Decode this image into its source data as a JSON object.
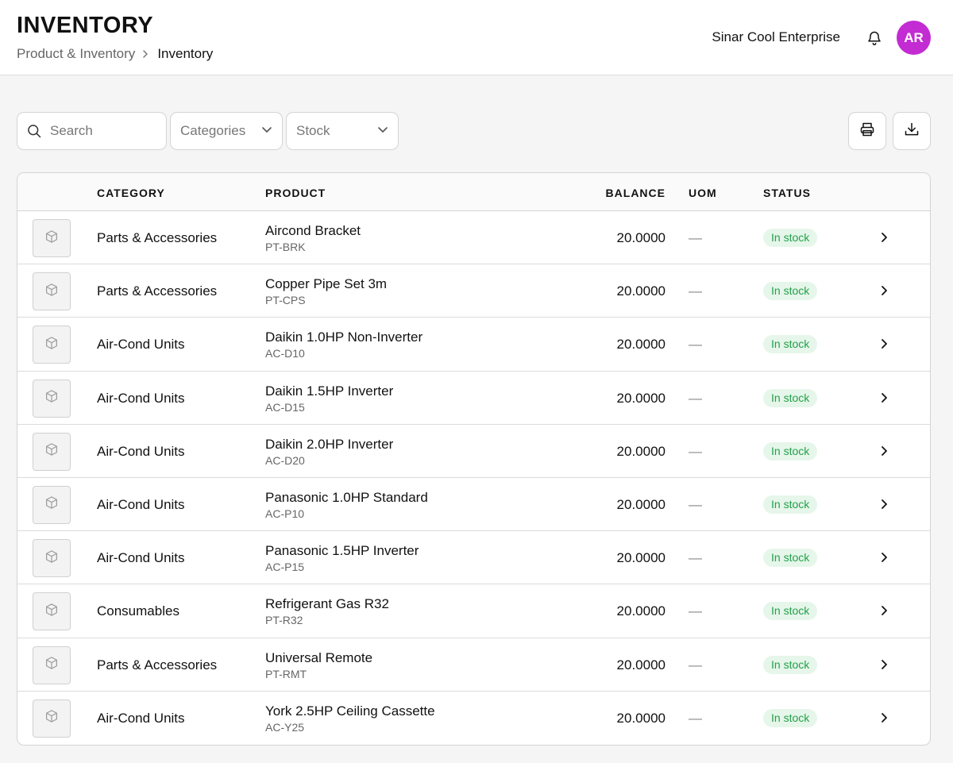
{
  "header": {
    "title": "INVENTORY",
    "breadcrumb": {
      "parent": "Product & Inventory",
      "current": "Inventory"
    },
    "company": "Sinar Cool Enterprise",
    "avatar_initials": "AR",
    "avatar_color": "#c32bd3",
    "icons": {
      "notifications": "bell-icon"
    }
  },
  "toolbar": {
    "search_placeholder": "Search",
    "categories_label": "Categories",
    "stock_label": "Stock",
    "icons": {
      "search": "search-icon",
      "print": "printer-icon",
      "download": "download-icon"
    }
  },
  "table": {
    "columns": {
      "category": "CATEGORY",
      "product": "PRODUCT",
      "balance": "BALANCE",
      "uom": "UOM",
      "status": "STATUS"
    },
    "status_colors": {
      "bg": "#e6f6ea",
      "text": "#23a04a"
    },
    "rows": [
      {
        "category": "Parts & Accessories",
        "name": "Aircond Bracket",
        "code": "PT-BRK",
        "balance": "20.0000",
        "uom": "—",
        "status": "In stock"
      },
      {
        "category": "Parts & Accessories",
        "name": "Copper Pipe Set 3m",
        "code": "PT-CPS",
        "balance": "20.0000",
        "uom": "—",
        "status": "In stock"
      },
      {
        "category": "Air-Cond Units",
        "name": "Daikin 1.0HP Non-Inverter",
        "code": "AC-D10",
        "balance": "20.0000",
        "uom": "—",
        "status": "In stock"
      },
      {
        "category": "Air-Cond Units",
        "name": "Daikin 1.5HP Inverter",
        "code": "AC-D15",
        "balance": "20.0000",
        "uom": "—",
        "status": "In stock"
      },
      {
        "category": "Air-Cond Units",
        "name": "Daikin 2.0HP Inverter",
        "code": "AC-D20",
        "balance": "20.0000",
        "uom": "—",
        "status": "In stock"
      },
      {
        "category": "Air-Cond Units",
        "name": "Panasonic 1.0HP Standard",
        "code": "AC-P10",
        "balance": "20.0000",
        "uom": "—",
        "status": "In stock"
      },
      {
        "category": "Air-Cond Units",
        "name": "Panasonic 1.5HP Inverter",
        "code": "AC-P15",
        "balance": "20.0000",
        "uom": "—",
        "status": "In stock"
      },
      {
        "category": "Consumables",
        "name": "Refrigerant Gas R32",
        "code": "PT-R32",
        "balance": "20.0000",
        "uom": "—",
        "status": "In stock"
      },
      {
        "category": "Parts & Accessories",
        "name": "Universal Remote",
        "code": "PT-RMT",
        "balance": "20.0000",
        "uom": "—",
        "status": "In stock"
      },
      {
        "category": "Air-Cond Units",
        "name": "York 2.5HP Ceiling Cassette",
        "code": "AC-Y25",
        "balance": "20.0000",
        "uom": "—",
        "status": "In stock"
      }
    ]
  }
}
